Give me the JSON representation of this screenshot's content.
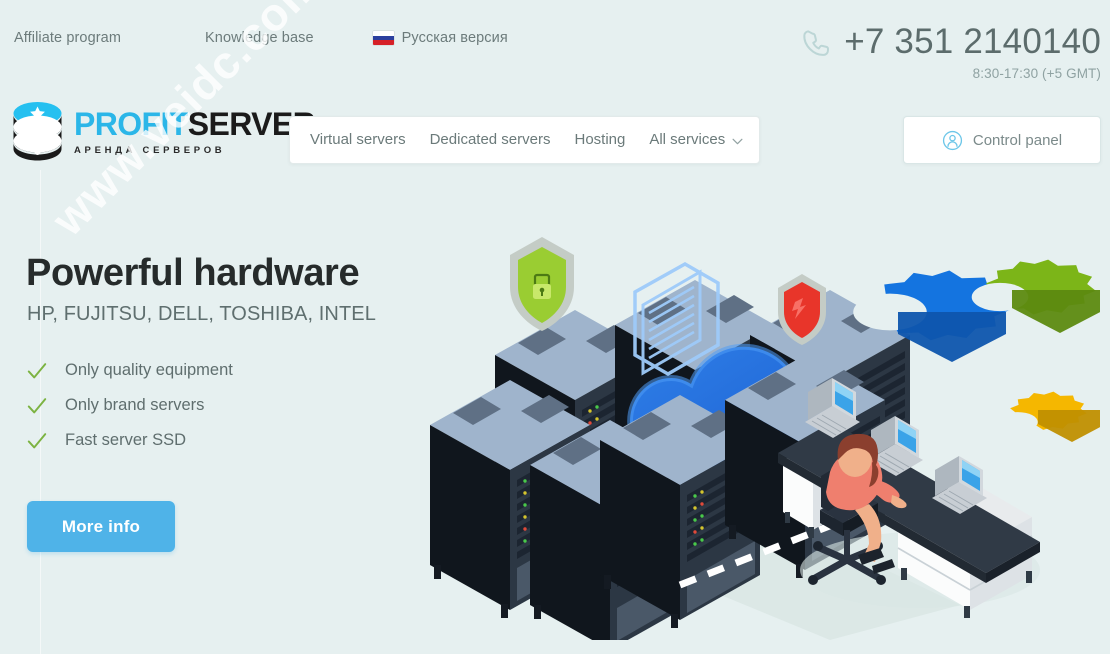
{
  "topbar": {
    "links": [
      {
        "label": "Affiliate program",
        "name": "affiliate-program-link"
      },
      {
        "label": "Knowledge base",
        "name": "knowledge-base-link"
      }
    ],
    "language": {
      "label": "Русская версия",
      "flag": "russian-flag-icon"
    },
    "phone": {
      "icon": "phone-icon",
      "number": "+7 351 2140140",
      "hours": "8:30-17:30 (+5 GMT)"
    }
  },
  "logo": {
    "icon": "database-star-icon",
    "word1": "PROFIT",
    "word2": "SERVER",
    "tagline": "АРЕНДА СЕРВЕРОВ"
  },
  "nav": {
    "items": [
      {
        "label": "Virtual servers"
      },
      {
        "label": "Dedicated servers"
      },
      {
        "label": "Hosting"
      },
      {
        "label": "All services"
      }
    ],
    "dropdown_icon": "chevron-down-icon"
  },
  "control_panel": {
    "label": "Control panel",
    "icon": "user-circle-icon"
  },
  "hero": {
    "title": "Powerful hardware",
    "subtitle": "HP, FUJITSU, DELL, TOSHIBA, INTEL",
    "features": [
      {
        "label": "Only quality equipment",
        "icon": "check-icon"
      },
      {
        "label": "Only brand servers",
        "icon": "check-icon"
      },
      {
        "label": "Fast server SSD",
        "icon": "check-icon"
      }
    ],
    "cta_label": "More info"
  },
  "illustration": {
    "name": "isometric-datacenter-illustration",
    "elements": [
      "server-rack",
      "blue-cloud",
      "document-icon",
      "green-shield-lock-icon",
      "red-shield-icon",
      "blue-gear",
      "green-gear",
      "yellow-gear",
      "person-at-desk",
      "laptop",
      "office-chair",
      "dashed-connection-line"
    ]
  },
  "watermark": {
    "text": "www.veidc.com"
  },
  "colors": {
    "background": "#e6f0f0",
    "accent_blue": "#4fb3e8",
    "logo_cyan": "#2bb6e8",
    "check_green": "#7cb342",
    "text_dark": "#262b2b",
    "text_muted": "#6c7b7b"
  }
}
